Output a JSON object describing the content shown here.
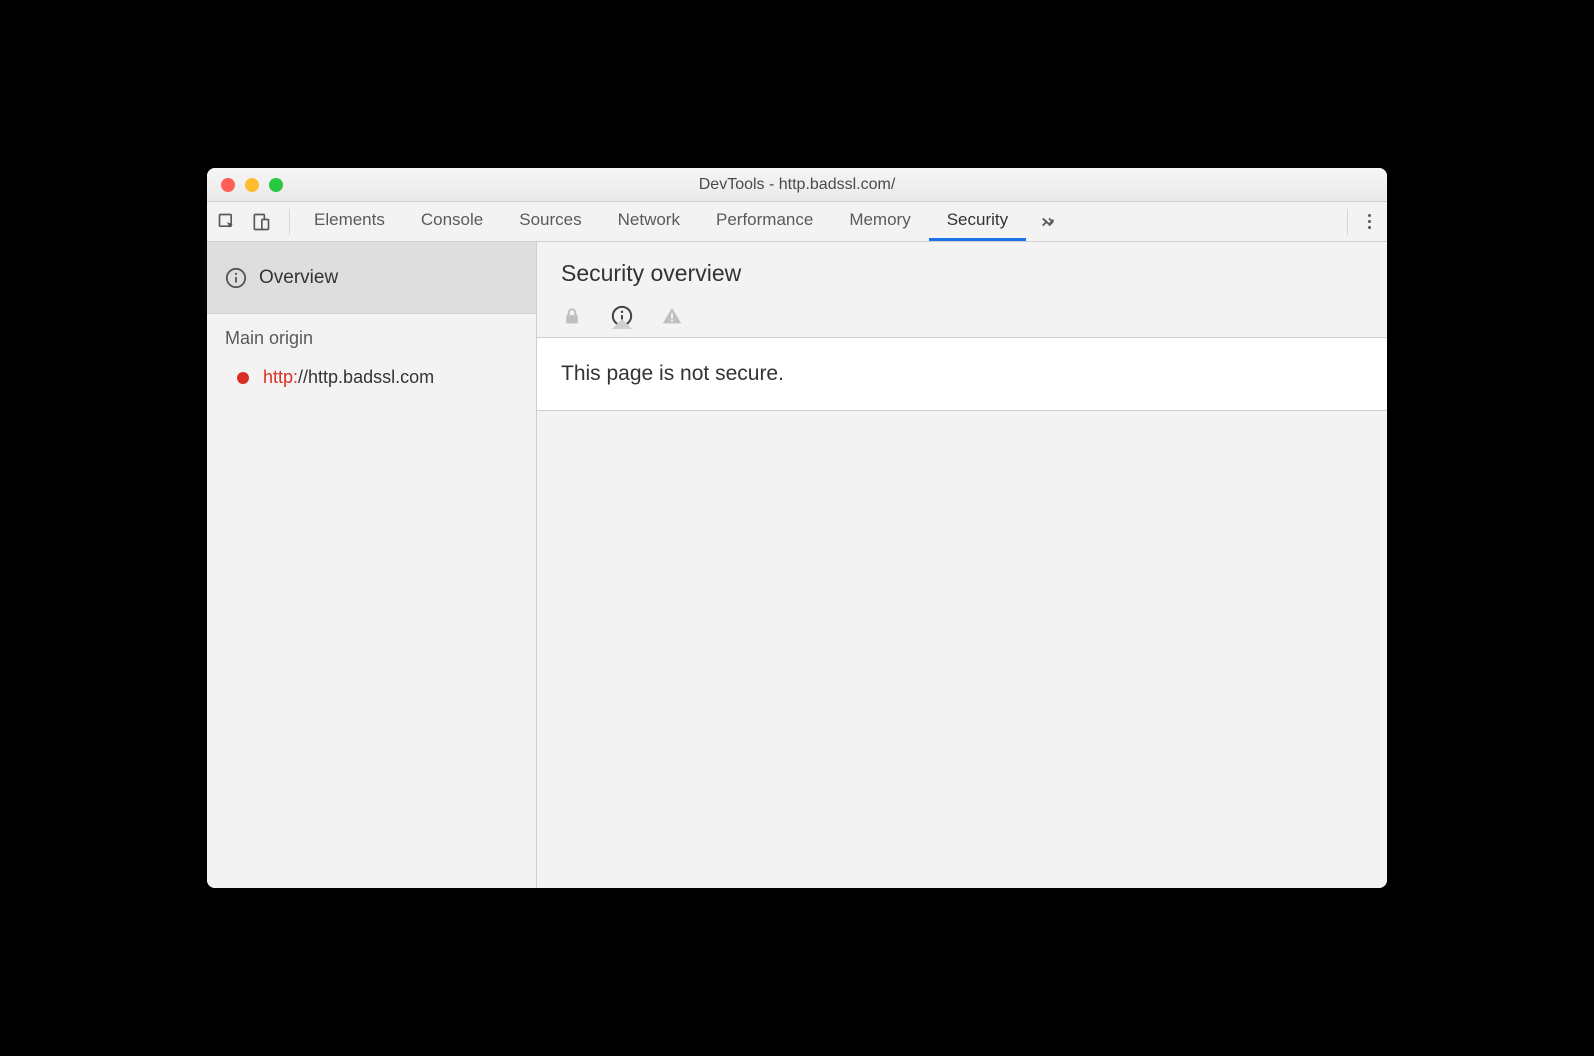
{
  "window": {
    "title": "DevTools - http.badssl.com/"
  },
  "toolbar": {
    "tabs": [
      {
        "label": "Elements"
      },
      {
        "label": "Console"
      },
      {
        "label": "Sources"
      },
      {
        "label": "Network"
      },
      {
        "label": "Performance"
      },
      {
        "label": "Memory"
      },
      {
        "label": "Security"
      }
    ],
    "active_tab_index": 6
  },
  "sidebar": {
    "overview_label": "Overview",
    "section_label": "Main origin",
    "origin": {
      "scheme": "http:",
      "rest": "//http.badssl.com",
      "status_color": "#d93025"
    }
  },
  "main": {
    "title": "Security overview",
    "message": "This page is not secure.",
    "active_status_index": 1
  }
}
